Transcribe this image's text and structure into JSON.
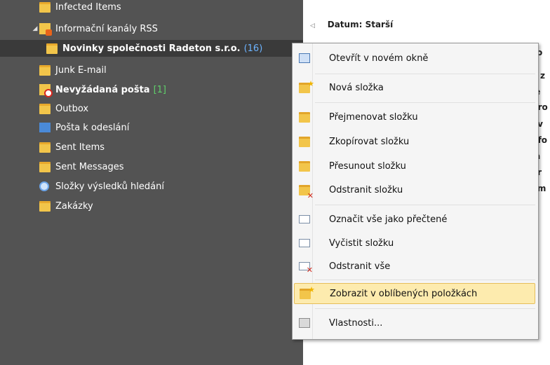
{
  "tree": {
    "items": [
      {
        "label": "Infected Items",
        "count": ""
      },
      {
        "label": "Informační kanály RSS",
        "count": ""
      },
      {
        "label": "Novinky společnosti Radeton s.r.o.",
        "count": "(16)"
      },
      {
        "label": "Junk E-mail",
        "count": ""
      },
      {
        "label": "Nevyžádaná pošta",
        "count": "[1]"
      },
      {
        "label": "Outbox",
        "count": ""
      },
      {
        "label": "Pošta k odeslání",
        "count": ""
      },
      {
        "label": "Sent Items",
        "count": ""
      },
      {
        "label": "Sent Messages",
        "count": ""
      },
      {
        "label": "Složky výsledků hledání",
        "count": ""
      },
      {
        "label": "Zakázky",
        "count": ""
      }
    ]
  },
  "message_list": {
    "group_header": "Datum: Starší",
    "fragments": [
      "zo",
      "y z",
      "le",
      "pro",
      "av",
      "pfo",
      "ja",
      "ár",
      "ým"
    ]
  },
  "context_menu": {
    "items": [
      {
        "label": "Otevřít v novém okně",
        "icon": "new-window-icon"
      },
      {
        "label": "Nová složka",
        "icon": "new-folder-icon"
      },
      {
        "label": "Přejmenovat složku",
        "icon": "rename-folder-icon"
      },
      {
        "label": "Zkopírovat složku",
        "icon": "copy-folder-icon"
      },
      {
        "label": "Přesunout složku",
        "icon": "move-folder-icon"
      },
      {
        "label": "Odstranit složku",
        "icon": "delete-folder-icon"
      },
      {
        "label": "Označit vše jako přečtené",
        "icon": "mark-all-read-icon"
      },
      {
        "label": "Vyčistit složku",
        "icon": "clean-folder-icon"
      },
      {
        "label": "Odstranit vše",
        "icon": "delete-all-icon"
      },
      {
        "label": "Zobrazit v oblíbených položkách",
        "icon": "favorites-icon",
        "highlighted": true
      },
      {
        "label": "Vlastnosti...",
        "icon": "properties-icon"
      }
    ]
  }
}
